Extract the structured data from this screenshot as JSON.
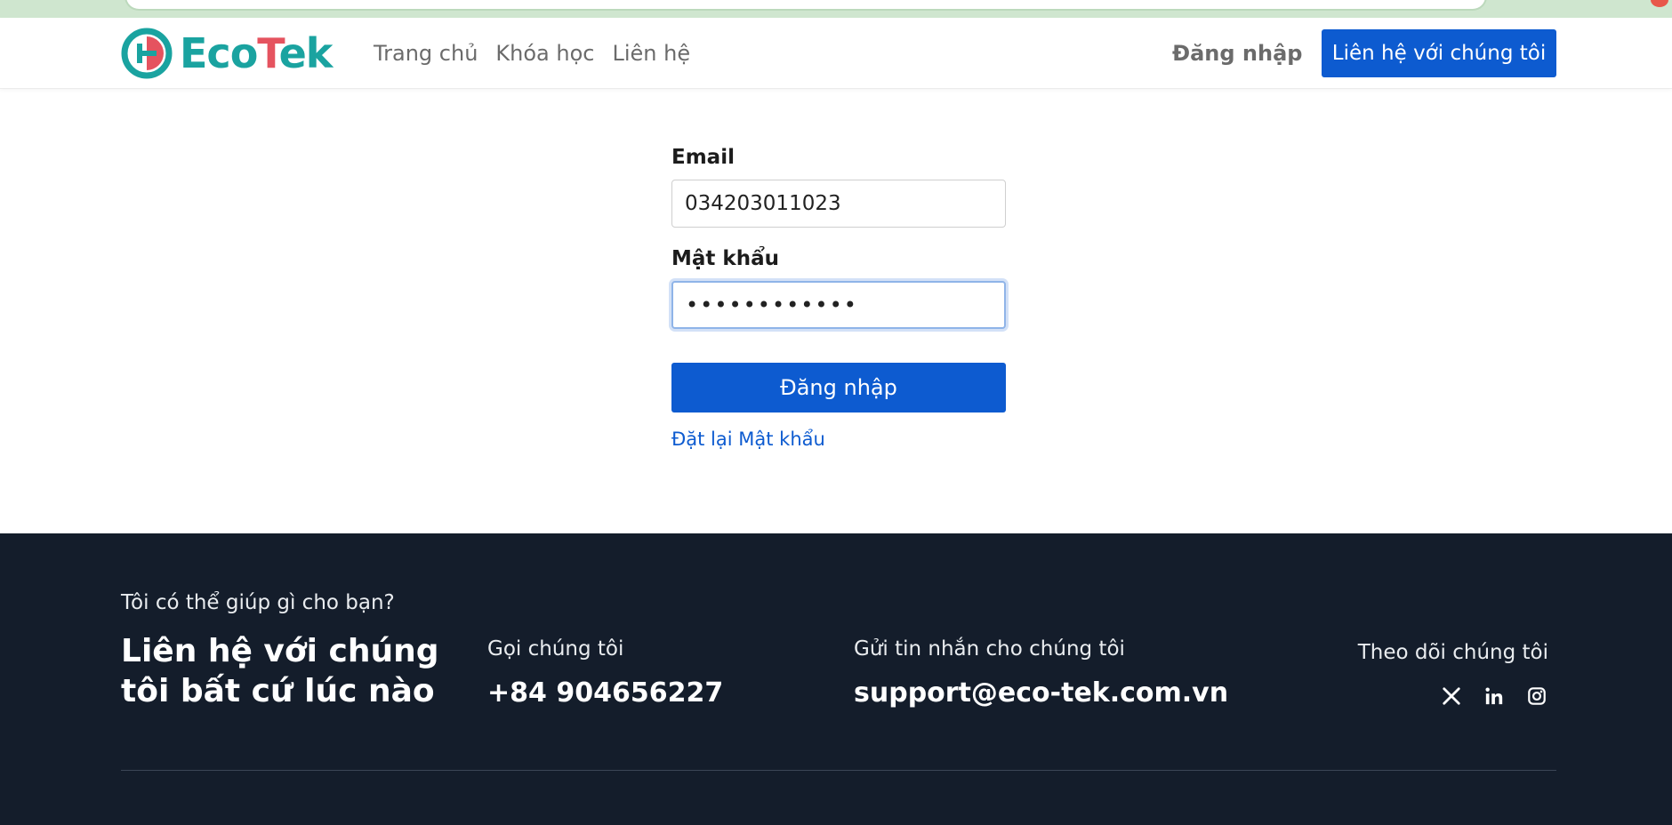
{
  "header": {
    "logo_text_eco": "Eco",
    "logo_text_t": "T",
    "logo_text_ek": "ek",
    "nav": [
      {
        "label": "Trang chủ"
      },
      {
        "label": "Khóa học"
      },
      {
        "label": "Liên hệ"
      }
    ],
    "login_label": "Đăng nhập",
    "contact_button": "Liên hệ với chúng tôi"
  },
  "form": {
    "email_label": "Email",
    "email_value": "034203011023",
    "password_label": "Mật khẩu",
    "password_value": "••••••••••••",
    "submit_label": "Đăng nhập",
    "reset_link": "Đặt lại Mật khẩu"
  },
  "footer": {
    "help": "Tôi có thể giúp gì cho bạn?",
    "headline": "Liên hệ với chúng tôi bất cứ lúc nào",
    "call_label": "Gọi chúng tôi",
    "call_value": "+84 904656227",
    "message_label": "Gửi tin nhắn cho chúng tôi",
    "message_value": "support@eco-tek.com.vn",
    "follow_label": "Theo dõi chúng tôi",
    "social_icons": [
      "x-icon",
      "linkedin-icon",
      "instagram-icon"
    ]
  },
  "colors": {
    "primary": "#0d5bd0",
    "logo_teal": "#1aa3a0",
    "logo_red": "#e5535f",
    "footer_bg": "#141d2b"
  }
}
